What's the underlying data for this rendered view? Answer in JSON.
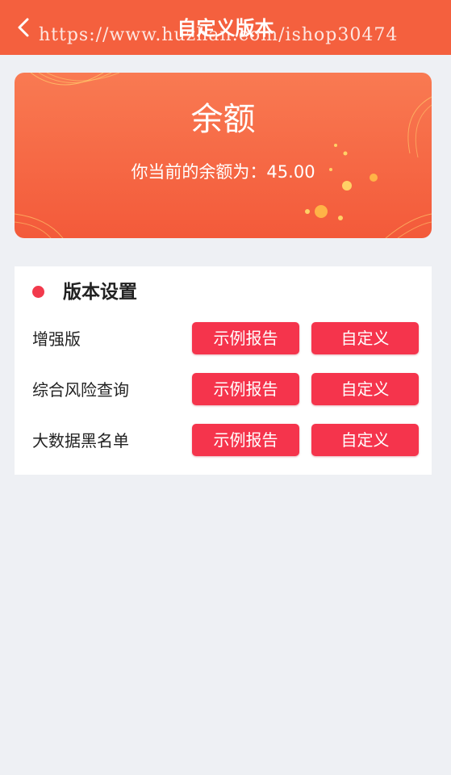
{
  "header": {
    "back_icon": "chevron-left-icon",
    "title": "自定义版本",
    "watermark": "https://www.huzhan.com/ishop30474"
  },
  "balance": {
    "title": "余额",
    "line": "你当前的余额为：45.00"
  },
  "colors": {
    "header_bg": "#f4603e",
    "card_bg": "#f35a3a",
    "button_bg": "#f5344c",
    "dot": "#f23a4c",
    "page_bg": "#eef0f4"
  },
  "section": {
    "title": "版本设置",
    "rows": [
      {
        "label": "增强版",
        "sample_label": "示例报告",
        "custom_label": "自定义"
      },
      {
        "label": "综合风险查询",
        "sample_label": "示例报告",
        "custom_label": "自定义"
      },
      {
        "label": "大数据黑名单",
        "sample_label": "示例报告",
        "custom_label": "自定义"
      }
    ]
  }
}
